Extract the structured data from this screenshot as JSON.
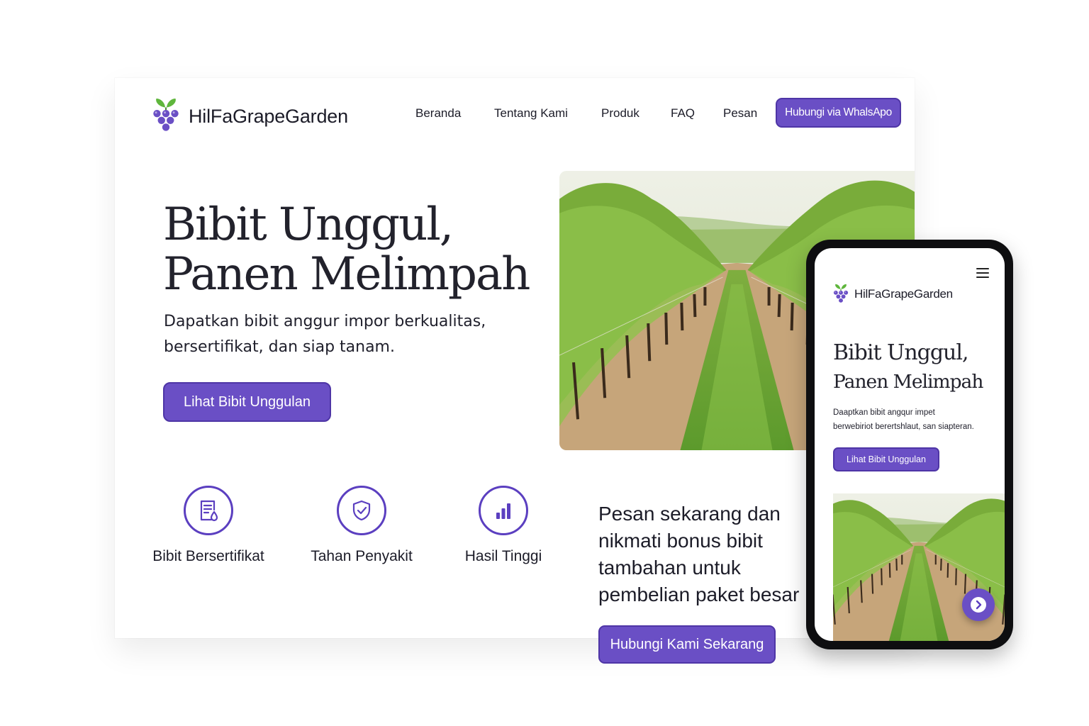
{
  "brand": {
    "name": "HilFaGrapeGarden"
  },
  "nav": {
    "items": [
      "Beranda",
      "Tentang Kami",
      "Produk",
      "FAQ",
      "Pesan"
    ],
    "whatsapp_button": "Hubungi via WhalsApo"
  },
  "hero": {
    "title_line1": "Bibit Unggul,",
    "title_line2": "Panen Melimpah",
    "subtitle_line1": "Dapatkan bibit anggur impor berkualitas,",
    "subtitle_line2": "bersertifikat, dan siap tanam.",
    "cta": "Lihat Bibit Unggulan"
  },
  "features": [
    {
      "label": "Bibit Bersertifikat",
      "icon": "certificate-icon"
    },
    {
      "label": "Tahan Penyakit",
      "icon": "shield-check-icon"
    },
    {
      "label": "Hasil Tinggi",
      "icon": "bar-chart-icon"
    }
  ],
  "promo": {
    "line1": "Pesan sekarang dan",
    "line2": "nikmati bonus bibit",
    "line3": "tambahan untuk",
    "line4": "pembelian paket besar",
    "cta": "Hubungi Kami Sekarang"
  },
  "mobile": {
    "brand": "HilFaGrapeGarden",
    "title_line1": "Bibit Unggul,",
    "title_line2": "Panen Melimpah",
    "subtitle_line1": "Daaptkan bibit angqur impet",
    "subtitle_line2": "berwebiriot berertshlaut, san siapteran.",
    "cta": "Lihat Bibit Unggulan",
    "fab_icon": "chevron-right-icon"
  },
  "colors": {
    "accent": "#6a4fc5",
    "accent_border": "#4e35a6",
    "grape": "#6a4fc5",
    "leaf": "#5fb63c",
    "text": "#1c1c28"
  }
}
